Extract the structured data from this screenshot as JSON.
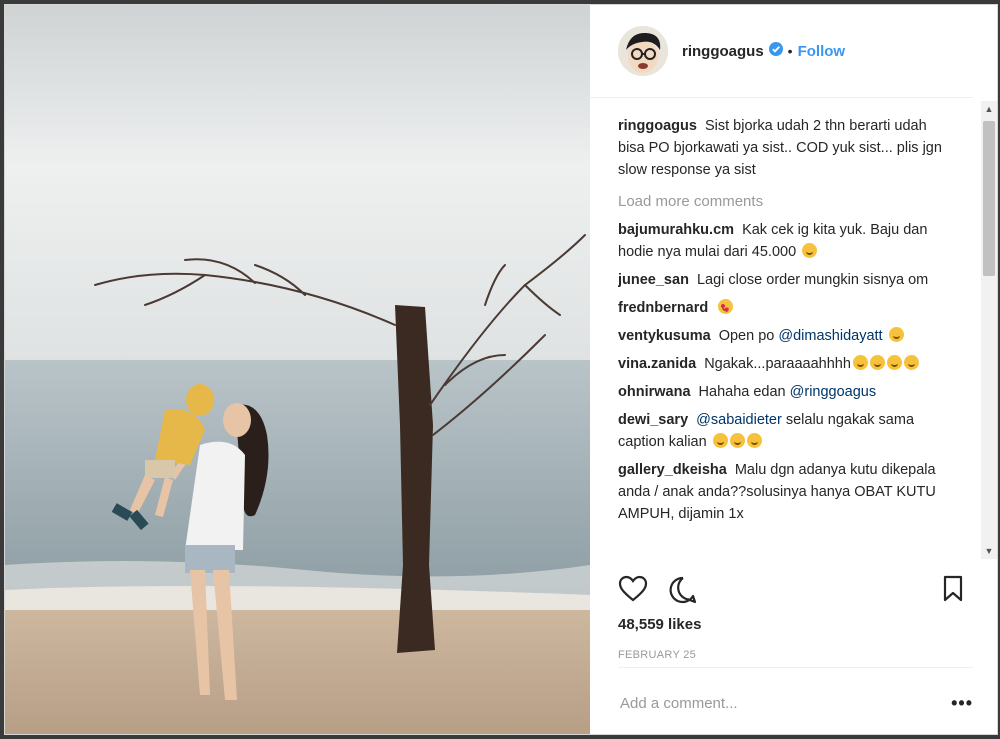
{
  "post": {
    "author": "ringgoagus",
    "follow_label": "Follow",
    "separator": "•",
    "likes": "48,559 likes",
    "date": "FEBRUARY 25",
    "add_comment_placeholder": "Add a comment...",
    "more_options": "•••",
    "accent_color": "#3897f0"
  },
  "caption": {
    "user": "ringgoagus",
    "text": "Sist bjorka udah 2 thn berarti udah bisa PO bjorkawati ya sist.. COD yuk sist... plis jgn slow response ya sist"
  },
  "load_more": "Load more comments",
  "comments": [
    {
      "user": "bajumurahku.cm",
      "text": "Kak cek ig kita yuk. Baju dan hodie nya mulai dari 45.000"
    },
    {
      "user": "junee_san",
      "text": "Lagi close order mungkin sisnya om"
    },
    {
      "user": "frednbernard",
      "text": ""
    },
    {
      "user": "ventykusuma",
      "text": "Open po",
      "mention": "@dimashidayatt"
    },
    {
      "user": "vina.zanida",
      "text": "Ngakak...paraaaahhhh"
    },
    {
      "user": "ohnirwana",
      "text": "Hahaha edan",
      "mention": "@ringgoagus"
    },
    {
      "user": "dewi_sary",
      "mention": "@sabaidieter",
      "text": "selalu ngakak sama caption kalian"
    },
    {
      "user": "gallery_dkeisha",
      "text": "Malu dgn adanya kutu dikepala anda / anak anda??solusinya hanya OBAT KUTU AMPUH, dijamin 1x"
    }
  ],
  "icons": {
    "like": "heart-icon",
    "comment": "comment-icon",
    "save": "bookmark-icon",
    "verified": "verified-badge-icon"
  }
}
